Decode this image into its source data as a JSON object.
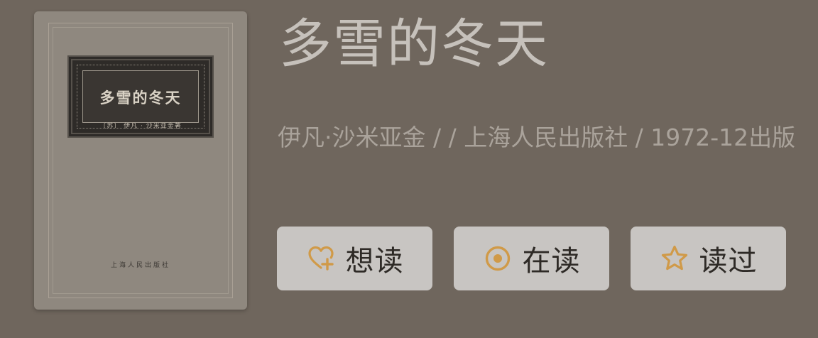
{
  "book": {
    "title": "多雪的冬天",
    "meta_line": "伊凡·沙米亚金 / / 上海人民出版社 / 1972-12出版"
  },
  "cover": {
    "title": "多雪的冬天",
    "author": "〔苏〕 伊凡 · 沙米亚金著",
    "publisher": "上海人民出版社"
  },
  "actions": {
    "want": {
      "label": "想读",
      "icon": "heart-plus-icon"
    },
    "reading": {
      "label": "在读",
      "icon": "target-circle-icon"
    },
    "read": {
      "label": "读过",
      "icon": "star-icon"
    }
  },
  "colors": {
    "accent": "#d09a48",
    "background": "#6f665d",
    "button_bg": "#c8c5c2"
  }
}
